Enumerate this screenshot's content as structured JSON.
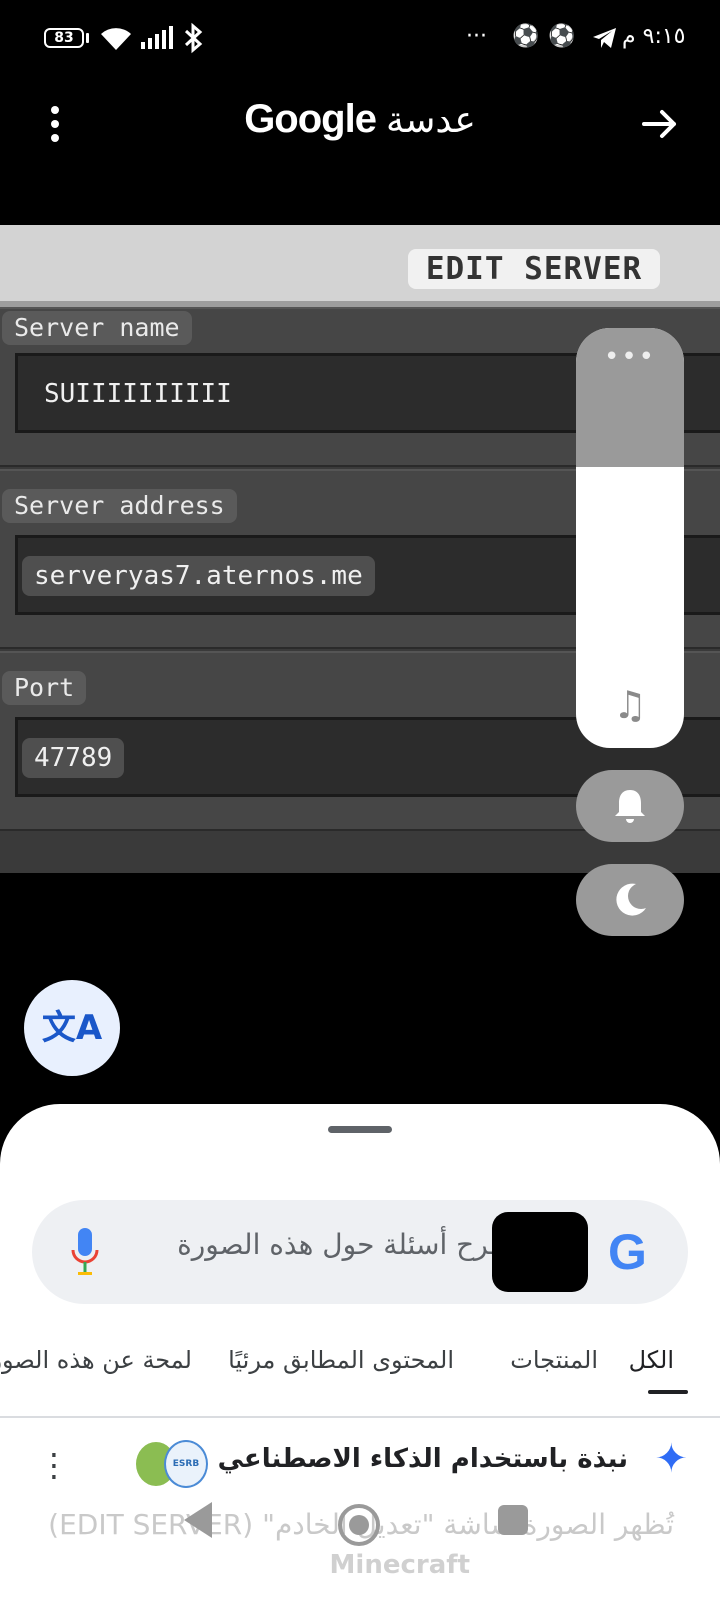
{
  "status_bar": {
    "battery": "83",
    "time": "٩:١٥ م",
    "overflow_dots": "···"
  },
  "header": {
    "google_label": "Google",
    "lens_label": "عدسة"
  },
  "screenshot": {
    "title": "EDIT SERVER",
    "server_name_label": "Server name",
    "server_name_value": "SUIIIIIIIIII",
    "server_address_label": "Server address",
    "server_address_value": "serveryas7.aternos.me",
    "port_label": "Port",
    "port_value": "47789"
  },
  "volume_panel": {
    "level": 0.7,
    "menu_dots": "•••"
  },
  "sheet": {
    "search_placeholder": "طرح أسئلة حول هذه الصورة",
    "tabs": [
      {
        "label": "الكل",
        "active": true
      },
      {
        "label": "المنتجات",
        "active": false
      },
      {
        "label": "المحتوى المطابق مرئيًا",
        "active": false
      },
      {
        "label": "لمحة عن هذه الصورة",
        "active": false
      }
    ],
    "ai_overview_title": "نبذة باستخدام الذكاء الاصطناعي",
    "ai_overview_text": "تُظهر الصورة شاشة \"تعديل الخادم\" (EDIT SERVER)",
    "ai_overview_text2": "Minecraft"
  },
  "icons": {
    "translate": "translate-icon",
    "mic": "mic-icon",
    "google": "google-g-icon",
    "sparkle": "sparkle-icon"
  }
}
